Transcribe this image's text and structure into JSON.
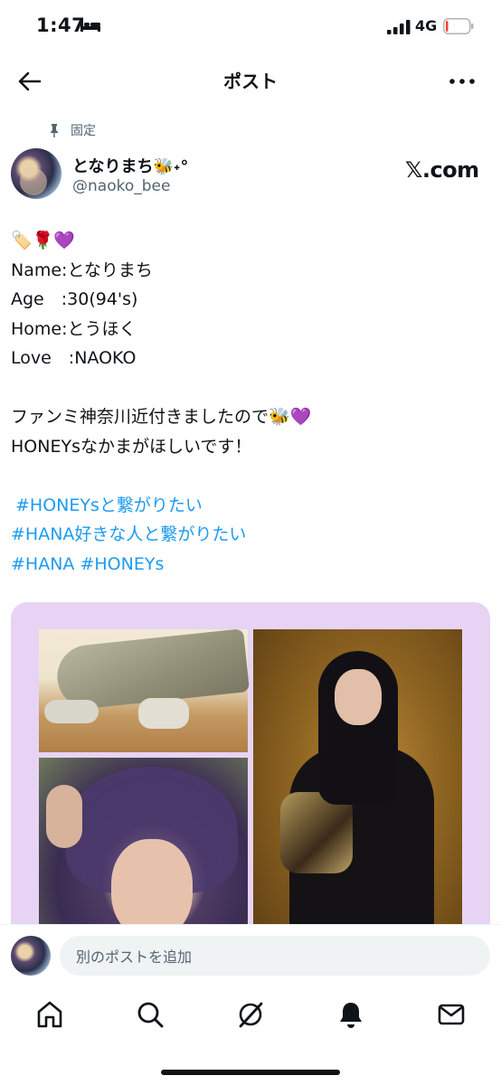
{
  "status_bar": {
    "time": "1:47",
    "sleep_icon": "bed-icon",
    "network": "4G",
    "battery_level": 0.08,
    "battery_color": "#ff3b30"
  },
  "header": {
    "title": "ポスト",
    "back_icon": "arrow-left-icon",
    "more_icon": "more-horizontal-icon"
  },
  "post": {
    "pinned_label": "固定",
    "display_name": "となりまち🐝˖°",
    "username": "@naoko_bee",
    "watermark": "𝕏.com",
    "lines": [
      "🏷️🌹💜",
      "Name:となりまち",
      "Age　:30(94's)",
      "Home:とうほく",
      "Love　:NAOKO",
      "",
      "ファンミ神奈川近付きましたので🐝💜",
      "HONEYsなかまがほしいです！",
      ""
    ],
    "hashtags": [
      "#HONEYsと繋がりたい",
      "#HANA好きな人と繋がりたい",
      "#HANA #HONEYs"
    ],
    "hashtag_color": "#1d9bf0",
    "media_background": "#e7d3f3"
  },
  "reply": {
    "placeholder": "別のポストを追加"
  },
  "tabs": [
    {
      "name": "home-icon"
    },
    {
      "name": "search-icon"
    },
    {
      "name": "grok-icon"
    },
    {
      "name": "notifications-icon"
    },
    {
      "name": "messages-icon"
    }
  ]
}
